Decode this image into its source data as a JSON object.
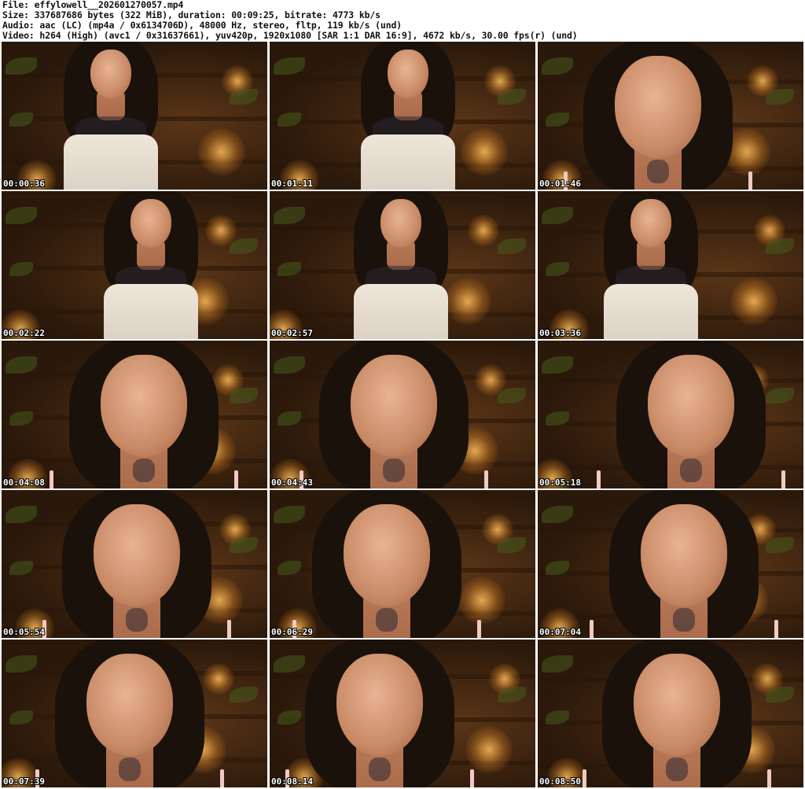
{
  "header": {
    "file_line": "File: effylowell__202601270057.mp4",
    "size_line": "Size: 337687686 bytes (322 MiB), duration: 00:09:25, bitrate: 4773 kb/s",
    "audio_line": "Audio: aac (LC) (mp4a / 0x6134706D), 48000 Hz, stereo, fltp, 119 kb/s (und)",
    "video_line": "Video: h264 (High) (avc1 / 0x31637661), yuv420p, 1920x1080 [SAR 1:1 DAR 16:9], 4672 kb/s, 30.00 fps(r) (und)"
  },
  "thumbnails": [
    {
      "timestamp": "00:00:36",
      "shot": "body"
    },
    {
      "timestamp": "00:01:11",
      "shot": "body"
    },
    {
      "timestamp": "00:01:46",
      "shot": "face"
    },
    {
      "timestamp": "00:02:22",
      "shot": "body"
    },
    {
      "timestamp": "00:02:57",
      "shot": "body"
    },
    {
      "timestamp": "00:03:36",
      "shot": "body"
    },
    {
      "timestamp": "00:04:08",
      "shot": "face"
    },
    {
      "timestamp": "00:04:43",
      "shot": "face"
    },
    {
      "timestamp": "00:05:18",
      "shot": "face"
    },
    {
      "timestamp": "00:05:54",
      "shot": "face"
    },
    {
      "timestamp": "00:06:29",
      "shot": "face"
    },
    {
      "timestamp": "00:07:04",
      "shot": "face"
    },
    {
      "timestamp": "00:07:39",
      "shot": "face"
    },
    {
      "timestamp": "00:08:14",
      "shot": "face"
    },
    {
      "timestamp": "00:08:50",
      "shot": "face"
    }
  ],
  "colors": {
    "background": "#ffffff",
    "header_text": "#111111",
    "timestamp_text": "#ffffff",
    "timestamp_outline": "#000000",
    "scene_warm": "#5a3517",
    "scene_dark": "#2a180a"
  }
}
